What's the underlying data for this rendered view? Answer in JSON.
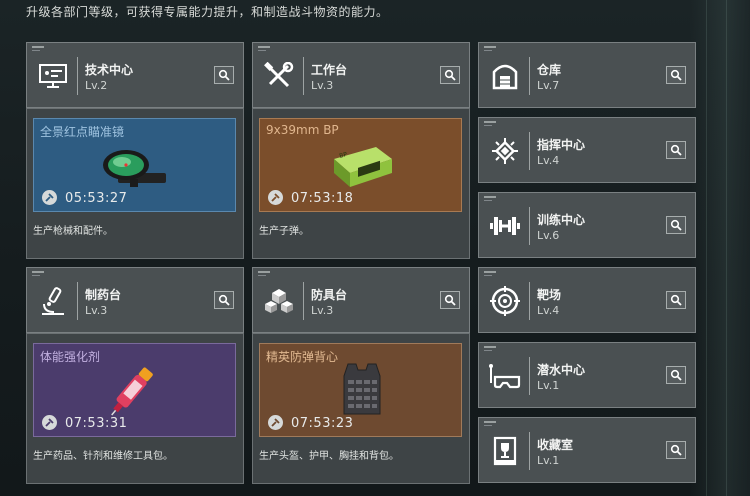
{
  "subtitle": "升级各部门等级，可获得专属能力提升，和制造战斗物资的能力。",
  "stations": {
    "tech": {
      "name": "技术中心",
      "level": "Lv.2",
      "icon": "monitor-icon",
      "product": "全景红点瞄准镜",
      "timer": "05:53:27",
      "desc": "生产枪械和配件。",
      "color": "#2f5f86"
    },
    "workbench": {
      "name": "工作台",
      "level": "Lv.3",
      "icon": "tools-icon",
      "product": "9x39mm BP",
      "timer": "07:53:18",
      "desc": "生产子弹。",
      "color": "#7a4f2c"
    },
    "medstation": {
      "name": "制药台",
      "level": "Lv.3",
      "icon": "microscope-icon",
      "product": "体能强化剂",
      "timer": "07:53:31",
      "desc": "生产药品、针剂和维修工具包。",
      "color": "#4f3f70"
    },
    "armor": {
      "name": "防具台",
      "level": "Lv.3",
      "icon": "boxes-icon",
      "product": "精英防弹背心",
      "timer": "07:53:23",
      "desc": "生产头盔、护甲、胸挂和背包。",
      "color": "#6e4a30"
    }
  },
  "side": [
    {
      "name": "仓库",
      "level": "Lv.7",
      "icon": "warehouse-icon"
    },
    {
      "name": "指挥中心",
      "level": "Lv.4",
      "icon": "chip-icon"
    },
    {
      "name": "训练中心",
      "level": "Lv.6",
      "icon": "dumbbell-icon"
    },
    {
      "name": "靶场",
      "level": "Lv.4",
      "icon": "target-icon"
    },
    {
      "name": "潜水中心",
      "level": "Lv.1",
      "icon": "goggles-icon"
    },
    {
      "name": "收藏室",
      "level": "Lv.1",
      "icon": "trophy-icon"
    }
  ]
}
